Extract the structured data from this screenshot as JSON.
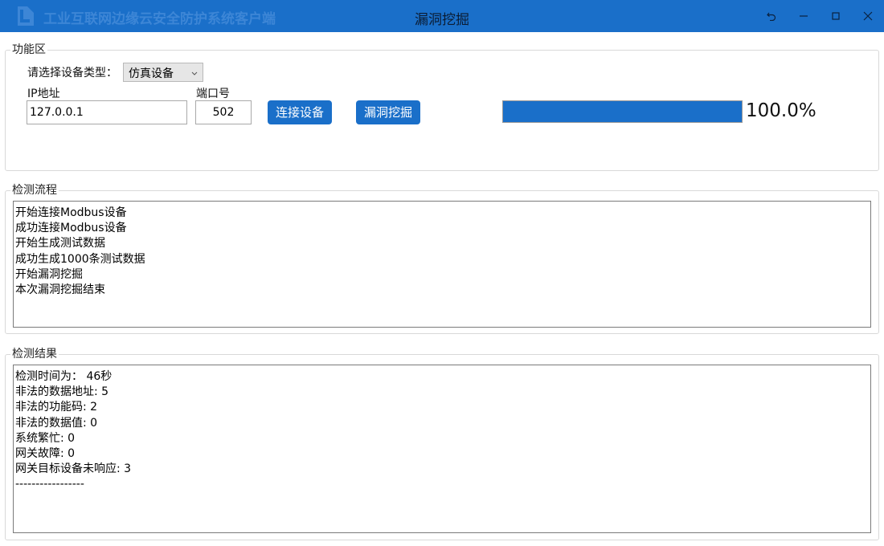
{
  "app": {
    "name": "工业互联网边缘云安全防护系统客户端",
    "window_title": "漏洞挖掘"
  },
  "function_area": {
    "legend": "功能区",
    "device_type_label": "请选择设备类型：",
    "device_type_value": "仿真设备",
    "ip_label": "IP地址",
    "ip_value": "127.0.0.1",
    "port_label": "端口号",
    "port_value": "502",
    "connect_button": "连接设备",
    "scan_button": "漏洞挖掘",
    "progress_percent": 100,
    "progress_text": "100.0%"
  },
  "process": {
    "legend": "检测流程",
    "lines": [
      "开始连接Modbus设备",
      "成功连接Modbus设备",
      "开始生成测试数据",
      "成功生成1000条测试数据",
      "开始漏洞挖掘",
      "本次漏洞挖掘结束"
    ]
  },
  "results": {
    "legend": "检测结果",
    "lines": [
      "检测时间为： 46秒",
      "非法的数据地址: 5",
      "非法的功能码: 2",
      "非法的数据值: 0",
      "系统繁忙: 0",
      "网关故障: 0",
      "网关目标设备未响应: 3",
      "-----------------"
    ]
  },
  "colors": {
    "accent": "#1a6fc9",
    "titlebar": "#1a6fc9"
  },
  "icons": {
    "logo": "app-logo-icon",
    "restore": "undo-icon",
    "minimize": "minimize-icon",
    "maximize": "maximize-icon",
    "close": "close-icon",
    "dropdown": "chevron-down-icon"
  }
}
